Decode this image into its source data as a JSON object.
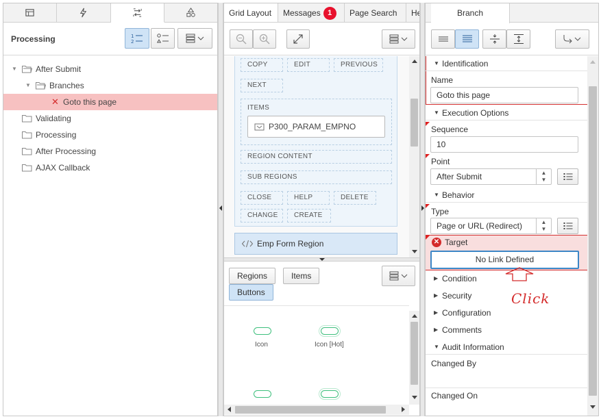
{
  "left": {
    "tabs": [
      {
        "icon": "table-icon"
      },
      {
        "icon": "lightning-icon"
      },
      {
        "icon": "processing-icon"
      },
      {
        "icon": "shared-components-icon"
      }
    ],
    "header": {
      "title": "Processing"
    },
    "tree": [
      {
        "label": "After Submit",
        "level": 0,
        "expanded": true
      },
      {
        "label": "Branches",
        "level": 1,
        "expanded": true
      },
      {
        "label": "Goto this page",
        "level": 2,
        "selected": true,
        "error": true
      },
      {
        "label": "Validating",
        "level": 0
      },
      {
        "label": "Processing",
        "level": 0
      },
      {
        "label": "After Processing",
        "level": 0
      },
      {
        "label": "AJAX Callback",
        "level": 0
      }
    ]
  },
  "middle": {
    "tabs": [
      {
        "label": "Grid Layout",
        "active": true
      },
      {
        "label": "Messages",
        "badge": "1"
      },
      {
        "label": "Page Search"
      },
      {
        "label": "He"
      }
    ],
    "positions": {
      "copy": "COPY",
      "edit": "EDIT",
      "previous": "PREVIOUS",
      "next": "NEXT",
      "items": "ITEMS",
      "item_name": "P300_PARAM_EMPNO",
      "region_content": "REGION CONTENT",
      "sub_regions": "SUB REGIONS",
      "close": "CLOSE",
      "help": "HELP",
      "delete": "DELETE",
      "change": "CHANGE",
      "create": "CREATE"
    },
    "region_label": "Emp Form Region",
    "gallery_tabs": {
      "regions": "Regions",
      "items": "Items",
      "buttons": "Buttons"
    },
    "gallery": [
      {
        "label": "Icon"
      },
      {
        "label": "Icon [Hot]"
      }
    ]
  },
  "right": {
    "tab": "Branch",
    "sections": {
      "identification": "Identification",
      "execution": "Execution Options",
      "behavior": "Behavior",
      "condition": "Condition",
      "security": "Security",
      "configuration": "Configuration",
      "comments": "Comments",
      "audit": "Audit Information"
    },
    "props": {
      "name_label": "Name",
      "name_value": "Goto this page",
      "sequence_label": "Sequence",
      "sequence_value": "10",
      "point_label": "Point",
      "point_value": "After Submit",
      "type_label": "Type",
      "type_value": "Page or URL (Redirect)",
      "target_label": "Target",
      "target_value": "No Link Defined",
      "changed_by_label": "Changed By",
      "changed_on_label": "Changed On"
    },
    "annotation": "Click"
  },
  "colors": {
    "selection": "#f7c1c1",
    "error": "#d42b2b",
    "accent_blue": "#3b86c6",
    "badge": "#e8112d",
    "gallery_green": "#3dbf7c"
  }
}
